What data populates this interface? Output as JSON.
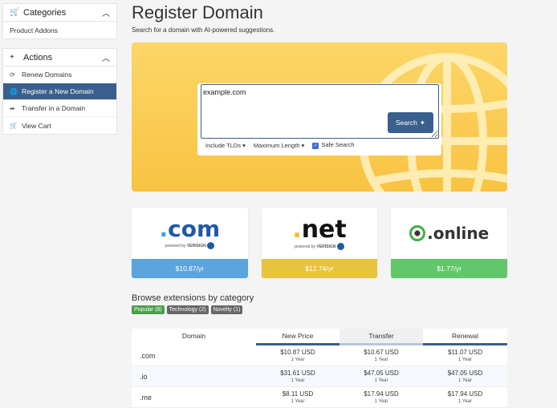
{
  "sidebar": {
    "categories": {
      "title": "Categories",
      "items": [
        {
          "label": "Product Addons"
        }
      ]
    },
    "actions": {
      "title": "Actions",
      "items": [
        {
          "label": "Renew Domains",
          "icon": "refresh-icon"
        },
        {
          "label": "Register a New Domain",
          "icon": "globe-icon",
          "active": true
        },
        {
          "label": "Transfer in a Domain",
          "icon": "share-icon"
        },
        {
          "label": "View Cart",
          "icon": "cart-icon"
        }
      ]
    }
  },
  "page": {
    "title": "Register Domain",
    "subtitle": "Search for a domain with AI-powered suggestions."
  },
  "search": {
    "value": "example.com",
    "button_label": "Search",
    "include_tlds": "Include TLDs",
    "max_length": "Maximum Length",
    "safe_search": "Safe Search"
  },
  "tlds": [
    {
      "name": ".com",
      "powered": "powered by",
      "brand": "VERISIGN",
      "price": "$10.87/yr",
      "color": "#5ba4dd"
    },
    {
      "name": ".net",
      "powered": "powered by",
      "brand": "VERISIGN",
      "price": "$12.74/yr",
      "color": "#e8c33c"
    },
    {
      "name": ".online",
      "price": "$1.77/yr",
      "color": "#62c76a"
    }
  ],
  "browse": {
    "title": "Browse extensions by category",
    "badges": [
      "Popular (8)",
      "Technology (2)",
      "Novelty (1)"
    ]
  },
  "table": {
    "headers": [
      "Domain",
      "New Price",
      "Transfer",
      "Renewal"
    ],
    "rows": [
      {
        "domain": ".com",
        "new": "$10.87 USD",
        "new_sub": "1 Year",
        "transfer": "$10.67 USD",
        "transfer_sub": "1 Year",
        "renewal": "$11.07 USD",
        "renewal_sub": "1 Year"
      },
      {
        "domain": ".io",
        "new": "$31.61 USD",
        "new_sub": "1 Year",
        "transfer": "$47.05 USD",
        "transfer_sub": "1 Year",
        "renewal": "$47.05 USD",
        "renewal_sub": "1 Year"
      },
      {
        "domain": ".me",
        "new": "$8.11 USD",
        "new_sub": "1 Year",
        "transfer": "$17.94 USD",
        "transfer_sub": "1 Year",
        "renewal": "$17.94 USD",
        "renewal_sub": "1 Year"
      }
    ]
  }
}
